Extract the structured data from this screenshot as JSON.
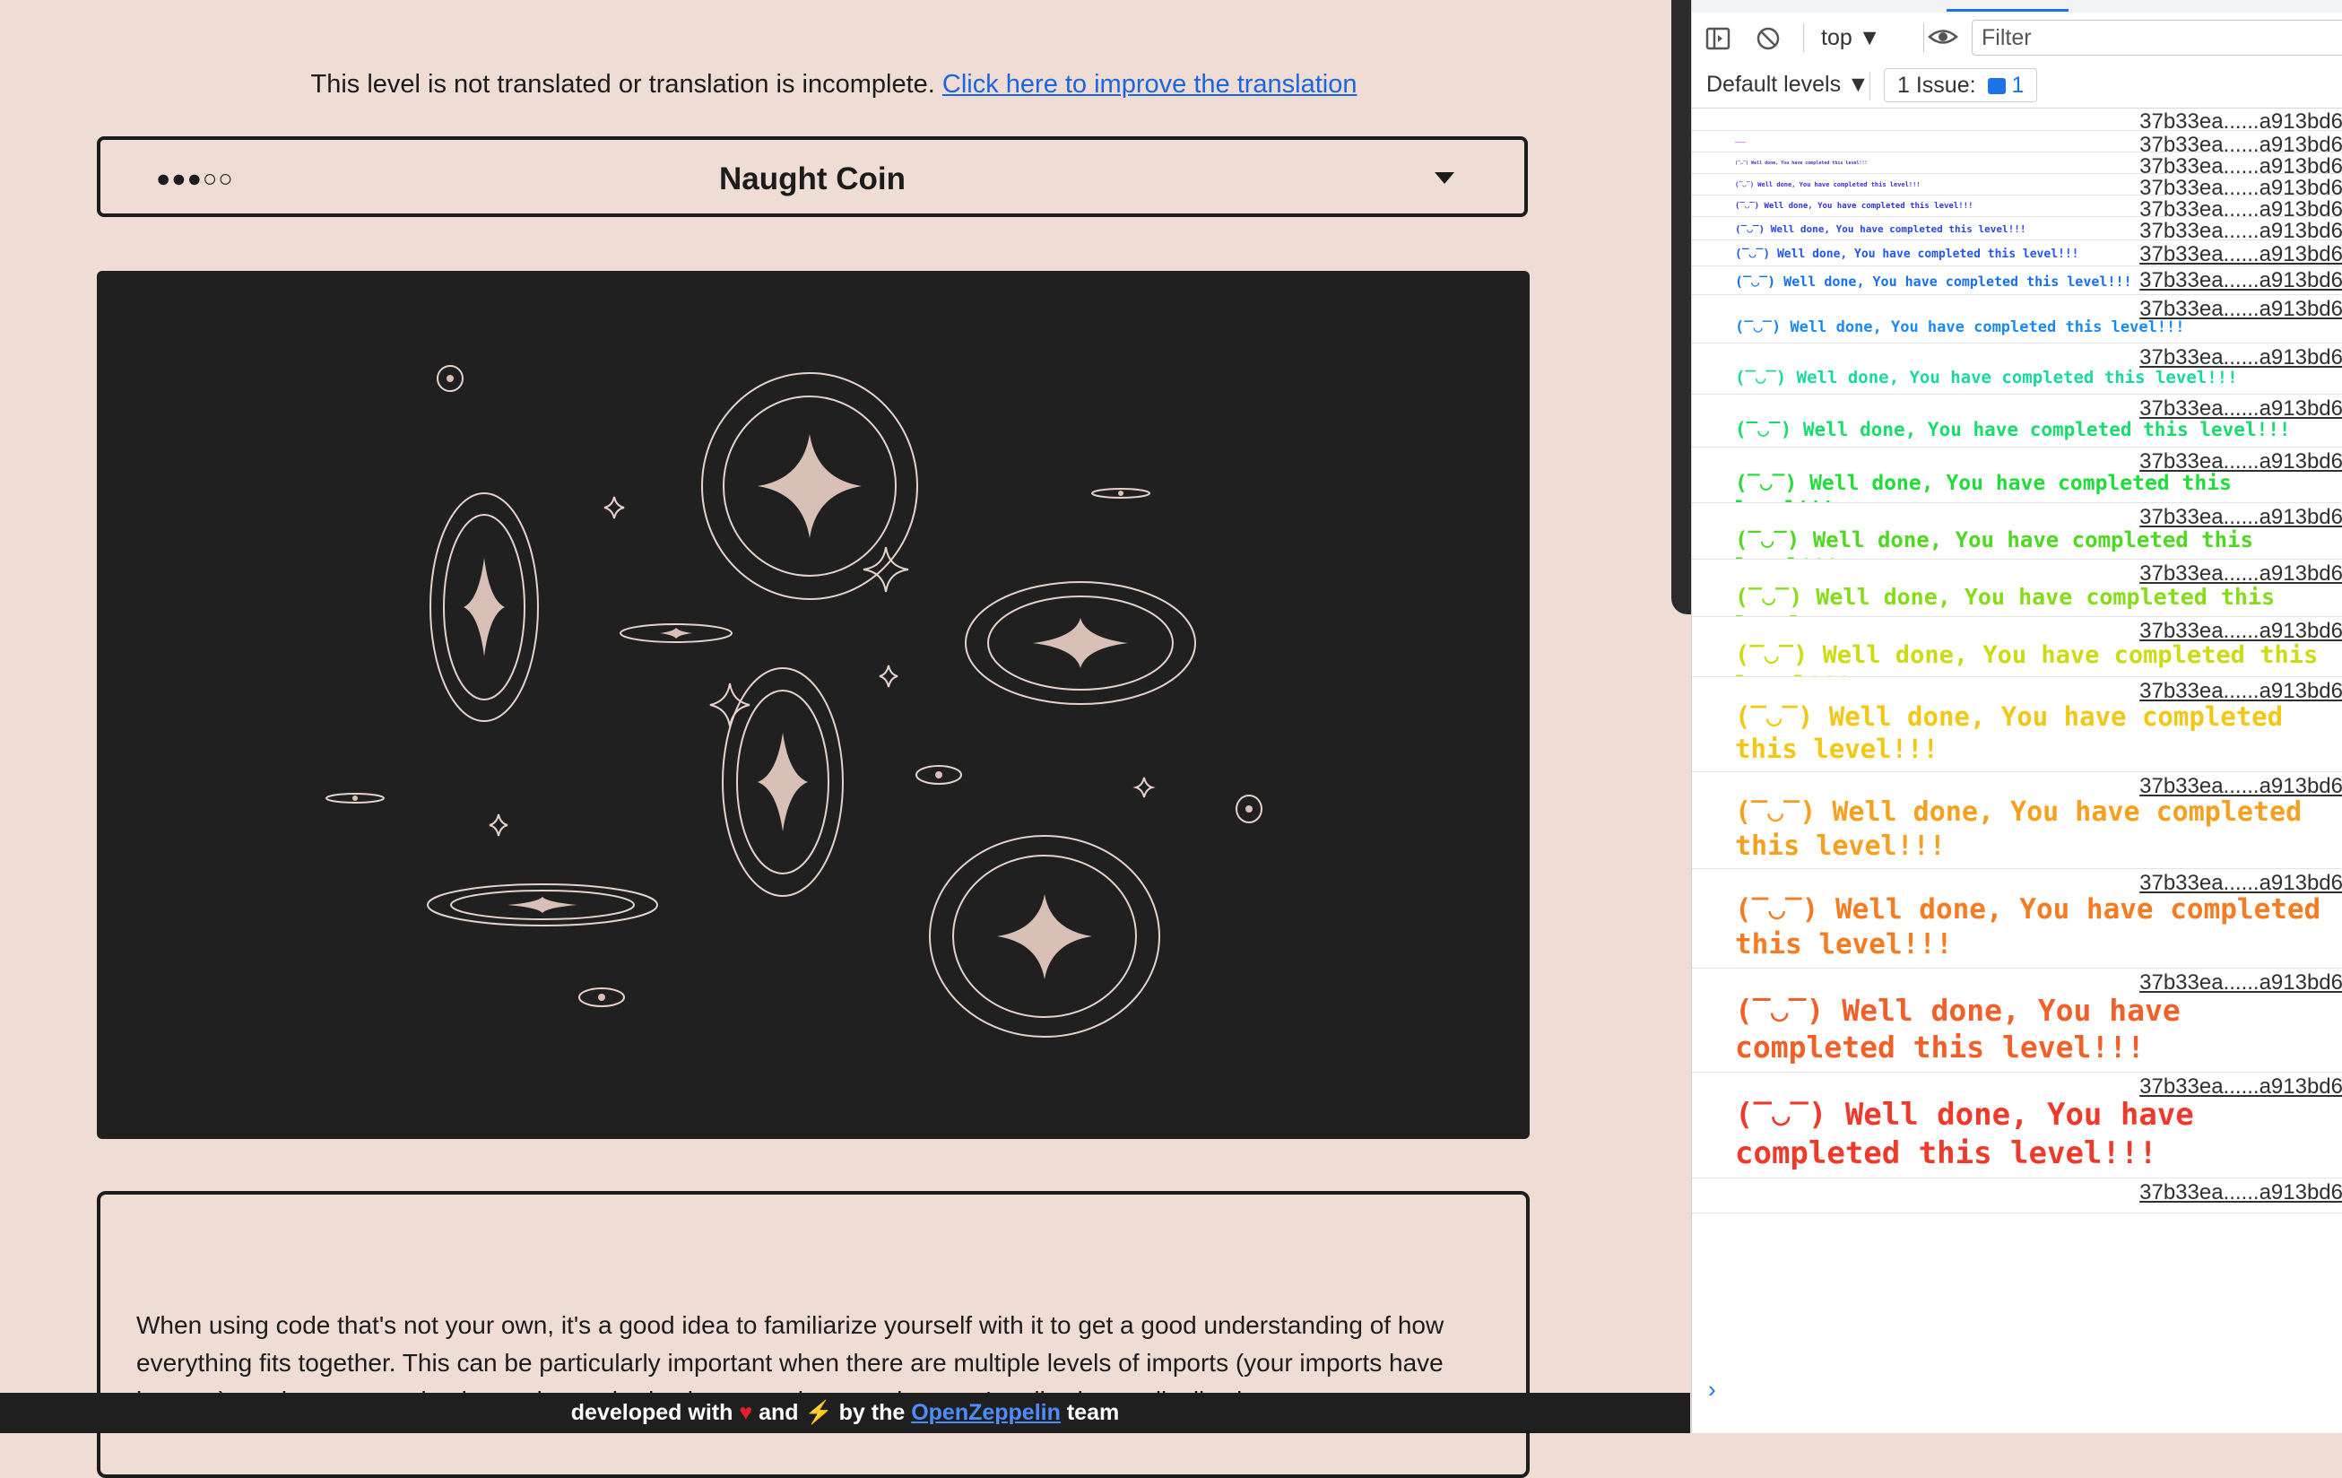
{
  "translation_notice": {
    "text": "This level is not translated or translation is incomplete.",
    "link": "Click here to improve the translation"
  },
  "level": {
    "difficulty": "●●●○○",
    "title": "Naught Coin"
  },
  "description": "When using code that's not your own, it's a good idea to familiarize yourself with it to get a good understanding of how everything fits together. This can be particularly important when there are multiple levels of imports (your imports have imports) or when you are implementing authorization controls, e.g. when you're allowing or disallowing",
  "footer": {
    "prefix": "developed with",
    "heart_icon": "heart-icon",
    "and": "and",
    "bolt_icon": "lightning-icon",
    "by_the": "by the",
    "link": "OpenZeppelin",
    "suffix": "team"
  },
  "devtools": {
    "context": "top ▼",
    "filter_placeholder": "Filter",
    "levels": "Default levels ▼",
    "issues_label": "1 Issue:",
    "issues_count": "1",
    "source": "37b33ea......a913bd6",
    "messages": [
      {
        "text": "",
        "color": "#ffffff",
        "size": 0
      },
      {
        "text": "—————",
        "color": "#a020f0",
        "size": 4
      },
      {
        "text": "(‾◡‾) Well done, You have completed this level!!!",
        "color": "#4b2bd0",
        "size": 5
      },
      {
        "text": "(‾◡‾) Well done, You have completed this level!!!",
        "color": "#3d2bd8",
        "size": 7
      },
      {
        "text": "(‾◡‾) Well done, You have completed this level!!!",
        "color": "#2f34e0",
        "size": 9
      },
      {
        "text": "(‾◡‾) Well done, You have completed this level!!!",
        "color": "#2846e8",
        "size": 11
      },
      {
        "text": "(‾◡‾) Well done, You have completed this level!!!",
        "color": "#2058f0",
        "size": 13
      },
      {
        "text": "(‾◡‾) Well done, You have completed this level!!!",
        "color": "#1670f5",
        "size": 15
      },
      {
        "text": "(‾◡‾) Well done, You have completed this level!!!",
        "color": "#1a8af0",
        "size": 17
      },
      {
        "text": "(‾◡‾) Well done, You have completed this level!!!",
        "color": "#19d8a0",
        "size": 19
      },
      {
        "text": "(‾◡‾) Well done, You have completed this level!!!",
        "color": "#19dc6e",
        "size": 21
      },
      {
        "text": "(‾◡‾) Well done, You have completed this level!!!",
        "color": "#22dc3c",
        "size": 23
      },
      {
        "text": "(‾◡‾) Well done, You have completed this level!!!",
        "color": "#4ed822",
        "size": 24
      },
      {
        "text": "(‾◡‾) Well done, You have completed this level!!!",
        "color": "#86dc18",
        "size": 25
      },
      {
        "text": "(‾◡‾) Well done, You have completed this level!!!",
        "color": "#ccdc14",
        "size": 27
      },
      {
        "text": "(‾◡‾) Well done, You have completed this level!!!",
        "color": "#f2c818",
        "size": 29
      },
      {
        "text": "(‾◡‾) Well done, You have completed this level!!!",
        "color": "#f5a01e",
        "size": 30
      },
      {
        "text": "(‾◡‾) Well done, You have completed this level!!!",
        "color": "#f57c22",
        "size": 31
      },
      {
        "text": "(‾◡‾) Well done, You have completed this level!!!",
        "color": "#f06028",
        "size": 33
      },
      {
        "text": "(‾◡‾) Well done, You have completed this level!!!",
        "color": "#ee3a2a",
        "size": 34
      },
      {
        "text": "",
        "color": "#ffffff",
        "size": 0
      }
    ],
    "prompt": "›"
  },
  "colors": {
    "page_bg": "#efdcd4",
    "image_bg": "#202020",
    "link": "#1a66e0"
  }
}
